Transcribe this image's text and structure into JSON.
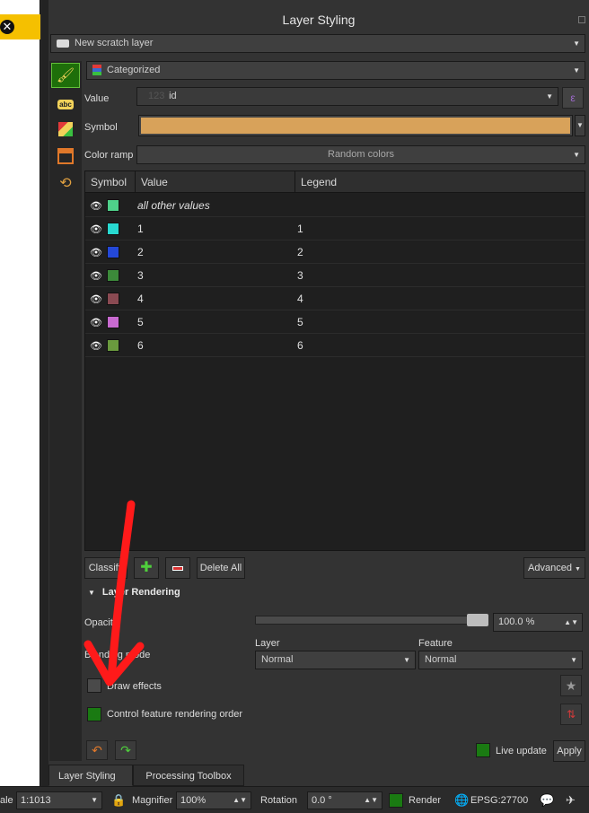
{
  "panel": {
    "title": "Layer Styling",
    "layer_name": "New scratch layer",
    "renderer": "Categorized"
  },
  "form": {
    "value_label": "Value",
    "value_field": "id",
    "symbol_label": "Symbol",
    "symbol_color": "#d8a25a",
    "ramp_label": "Color ramp",
    "ramp_value": "Random colors"
  },
  "table": {
    "headers": [
      "Symbol",
      "Value",
      "Legend"
    ],
    "rows": [
      {
        "value": "all other values",
        "legend": "",
        "color": "#4fd18a"
      },
      {
        "value": "1",
        "legend": "1",
        "color": "#28d9d0"
      },
      {
        "value": "2",
        "legend": "2",
        "color": "#2448d8"
      },
      {
        "value": "3",
        "legend": "3",
        "color": "#3c8a3a"
      },
      {
        "value": "4",
        "legend": "4",
        "color": "#8a4a52"
      },
      {
        "value": "5",
        "legend": "5",
        "color": "#c86ad0"
      },
      {
        "value": "6",
        "legend": "6",
        "color": "#6a9a3e"
      }
    ]
  },
  "buttons": {
    "classify": "Classify",
    "delete_all": "Delete All",
    "advanced": "Advanced",
    "apply": "Apply"
  },
  "rendering": {
    "section_title": "Layer Rendering",
    "opacity_label": "Opacity",
    "opacity_value": "100.0 %",
    "opacity_fraction": 1.0,
    "blending_label": "Blending mode",
    "layer_label": "Layer",
    "feature_label": "Feature",
    "layer_blend": "Normal",
    "feature_blend": "Normal",
    "draw_effects": "Draw effects",
    "control_order": "Control feature rendering order",
    "live_update": "Live update"
  },
  "tabs": {
    "layer_styling": "Layer Styling",
    "processing_toolbox": "Processing Toolbox"
  },
  "statusbar": {
    "scale_label": "ale",
    "scale_value": "1:1013",
    "magnifier_label": "Magnifier",
    "magnifier_value": "100%",
    "rotation_label": "Rotation",
    "rotation_value": "0.0 °",
    "render_label": "Render",
    "crs": "EPSG:27700"
  },
  "colors": {
    "annotation": "#ff1a1a",
    "active_tab": "#1e6e0a",
    "canvas_banner": "#f5c000"
  }
}
